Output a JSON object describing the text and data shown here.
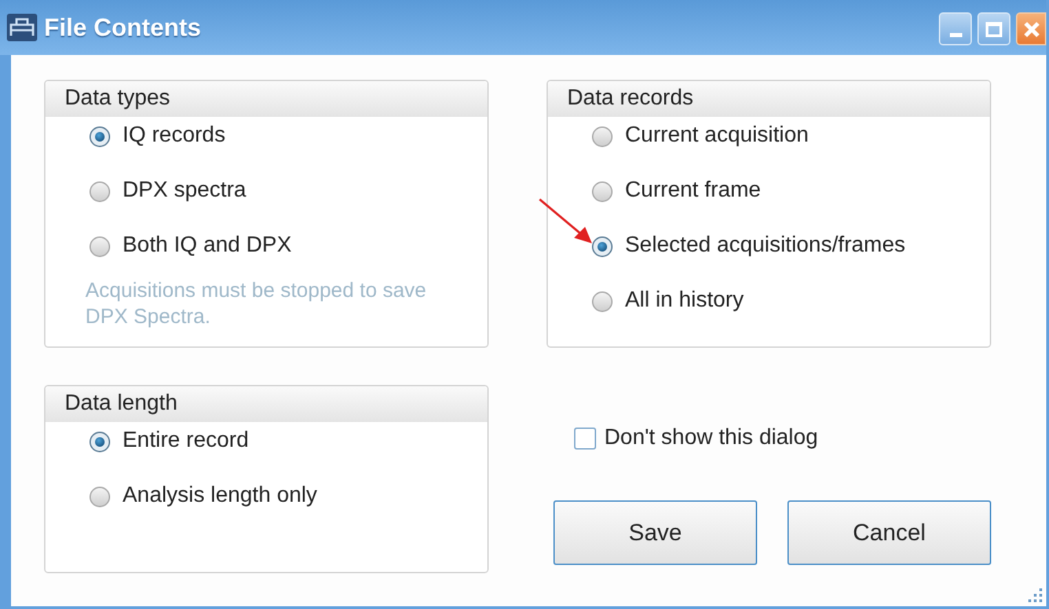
{
  "window": {
    "title": "File Contents"
  },
  "data_types": {
    "title": "Data types",
    "options": [
      {
        "label": "IQ records",
        "selected": true
      },
      {
        "label": "DPX spectra",
        "selected": false
      },
      {
        "label": "Both IQ and DPX",
        "selected": false
      }
    ],
    "note": "Acquisitions must be stopped to save DPX Spectra."
  },
  "data_records": {
    "title": "Data records",
    "options": [
      {
        "label": "Current acquisition",
        "selected": false
      },
      {
        "label": "Current frame",
        "selected": false
      },
      {
        "label": "Selected acquisitions/frames",
        "selected": true
      },
      {
        "label": "All in history",
        "selected": false
      }
    ]
  },
  "data_length": {
    "title": "Data length",
    "options": [
      {
        "label": "Entire record",
        "selected": true
      },
      {
        "label": "Analysis length only",
        "selected": false
      }
    ]
  },
  "dont_show_checkbox": {
    "label": "Don't show this dialog",
    "checked": false
  },
  "buttons": [
    "Save",
    "Cancel"
  ]
}
